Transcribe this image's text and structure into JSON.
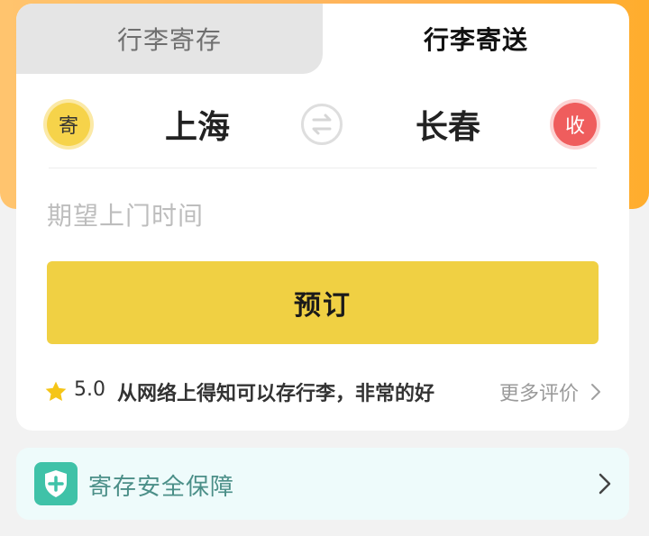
{
  "tabs": [
    {
      "label": "行李寄存",
      "active": false
    },
    {
      "label": "行李寄送",
      "active": true
    }
  ],
  "route": {
    "send_badge": "寄",
    "from_city": "上海",
    "swap_icon": "swap-arrows-icon",
    "to_city": "长春",
    "receive_badge": "收"
  },
  "pickup_time": {
    "placeholder": "期望上门时间"
  },
  "book_button": {
    "label": "预订"
  },
  "review": {
    "star_icon": "star-icon",
    "rating": "5.0",
    "text": "从网络上得知可以存行李，非常的好",
    "more_label": "更多评价"
  },
  "safety": {
    "label": "寄存安全保障",
    "icon": "shield-plus-icon"
  },
  "colors": {
    "accent_yellow": "#f0d043",
    "orange": "#ffad2d",
    "receive_red": "#ef5d5d",
    "safety_green": "#4b8f88"
  }
}
